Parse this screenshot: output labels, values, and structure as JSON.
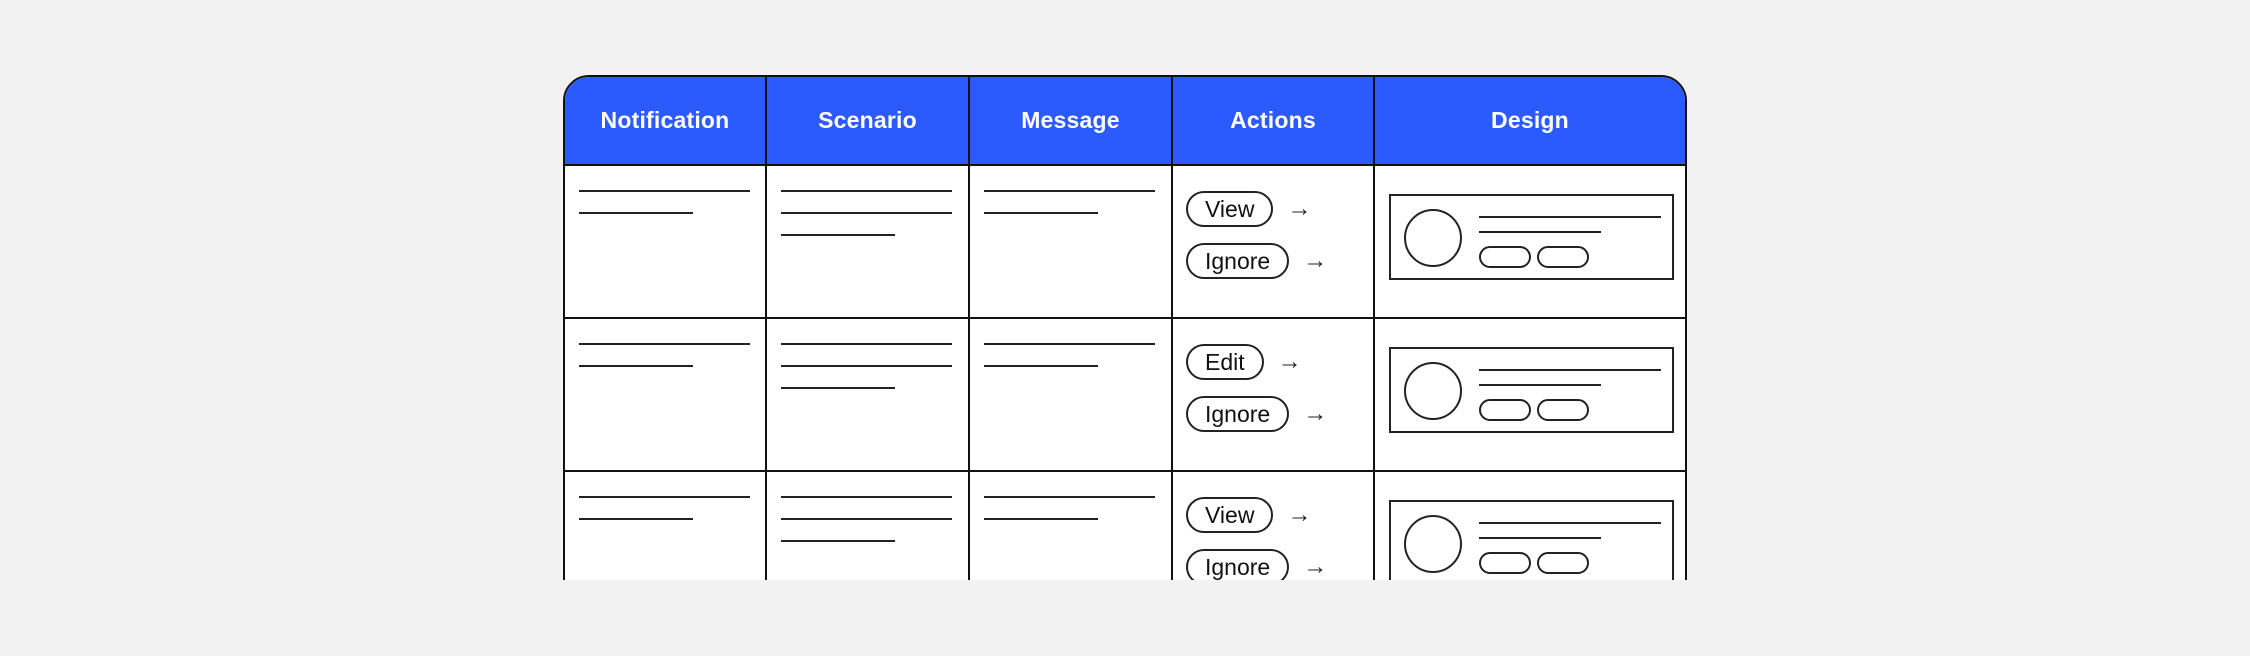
{
  "colors": {
    "page_background": "#f2f2f2",
    "header_background": "#2b5bff",
    "header_text": "#ffffff",
    "border": "#111111"
  },
  "table": {
    "columns": [
      {
        "key": "notification",
        "label": "Notification"
      },
      {
        "key": "scenario",
        "label": "Scenario"
      },
      {
        "key": "message",
        "label": "Message"
      },
      {
        "key": "actions",
        "label": "Actions"
      },
      {
        "key": "design",
        "label": "Design"
      }
    ],
    "rows": [
      {
        "notification_placeholder_lines": [
          "full",
          "short"
        ],
        "scenario_placeholder_lines": [
          "full",
          "full",
          "short"
        ],
        "message_placeholder_lines": [
          "full",
          "short"
        ],
        "actions": [
          {
            "label": "View",
            "icon": "arrow-right-icon",
            "arrow": "→"
          },
          {
            "label": "Ignore",
            "icon": "arrow-right-icon",
            "arrow": "→"
          }
        ],
        "design": "card-wireframe"
      },
      {
        "notification_placeholder_lines": [
          "full",
          "short"
        ],
        "scenario_placeholder_lines": [
          "full",
          "full",
          "short"
        ],
        "message_placeholder_lines": [
          "full",
          "short"
        ],
        "actions": [
          {
            "label": "Edit",
            "icon": "arrow-right-icon",
            "arrow": "→"
          },
          {
            "label": "Ignore",
            "icon": "arrow-right-icon",
            "arrow": "→"
          }
        ],
        "design": "card-wireframe"
      },
      {
        "notification_placeholder_lines": [
          "full",
          "short"
        ],
        "scenario_placeholder_lines": [
          "full",
          "full",
          "short"
        ],
        "message_placeholder_lines": [
          "full",
          "short"
        ],
        "actions": [
          {
            "label": "View",
            "icon": "arrow-right-icon",
            "arrow": "→"
          },
          {
            "label": "Ignore",
            "icon": "arrow-right-icon",
            "arrow": "→"
          }
        ],
        "design": "card-wireframe"
      }
    ]
  }
}
